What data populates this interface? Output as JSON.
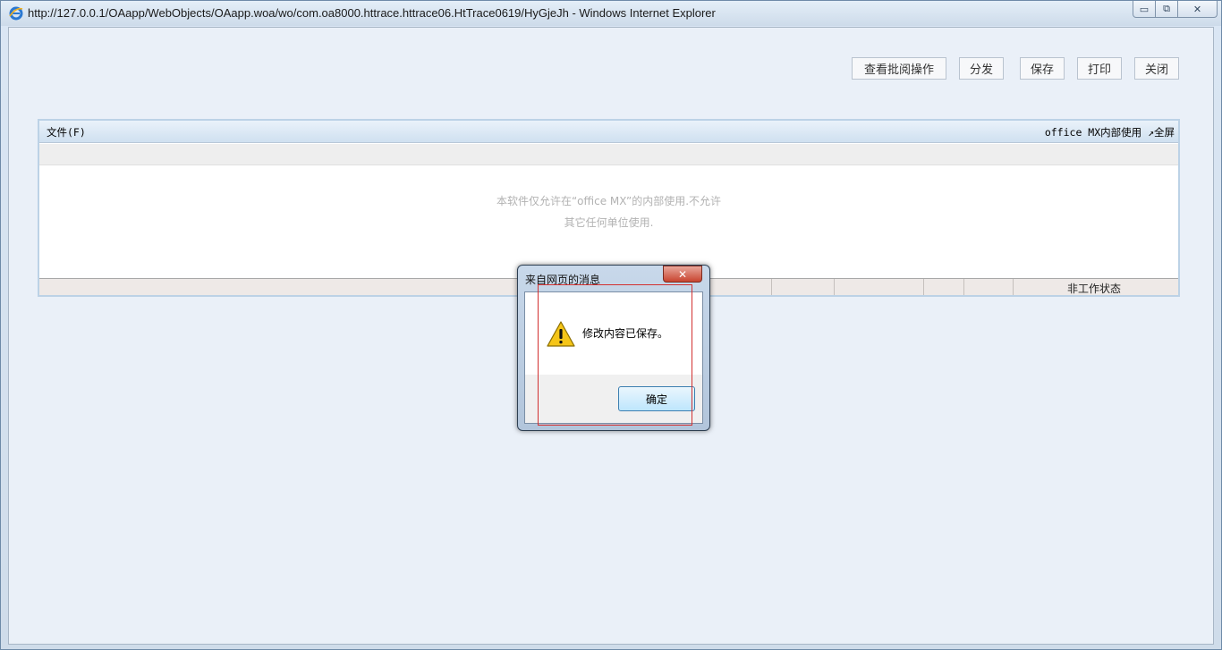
{
  "window": {
    "title": "http://127.0.0.1/OAapp/WebObjects/OAapp.woa/wo/com.oa8000.httrace.httrace06.HtTrace0619/HyGjeJh - Windows Internet Explorer",
    "icon": "ie-icon",
    "controls": {
      "minimize": "▭",
      "maximize": "⧉",
      "close": "✕"
    }
  },
  "toolbar": {
    "view_approval": "查看批阅操作",
    "distribute": "分发",
    "save": "保存",
    "print": "打印",
    "close": "关闭"
  },
  "office": {
    "menu_file": "文件(F)",
    "menu_right": "office MX内部使用 ↗全屏",
    "license_line1": "本软件仅允许在“office MX”的内部使用.不允许",
    "license_line2": "其它任何单位使用.",
    "status": "非工作状态"
  },
  "dialog": {
    "title": "来自网页的消息",
    "close_glyph": "✕",
    "message": "修改内容已保存。",
    "ok": "确定",
    "icon": "warning-icon"
  },
  "colors": {
    "accent": "#3c7fb1",
    "close_red": "#c8442f",
    "warning_yellow": "#f5c518"
  }
}
